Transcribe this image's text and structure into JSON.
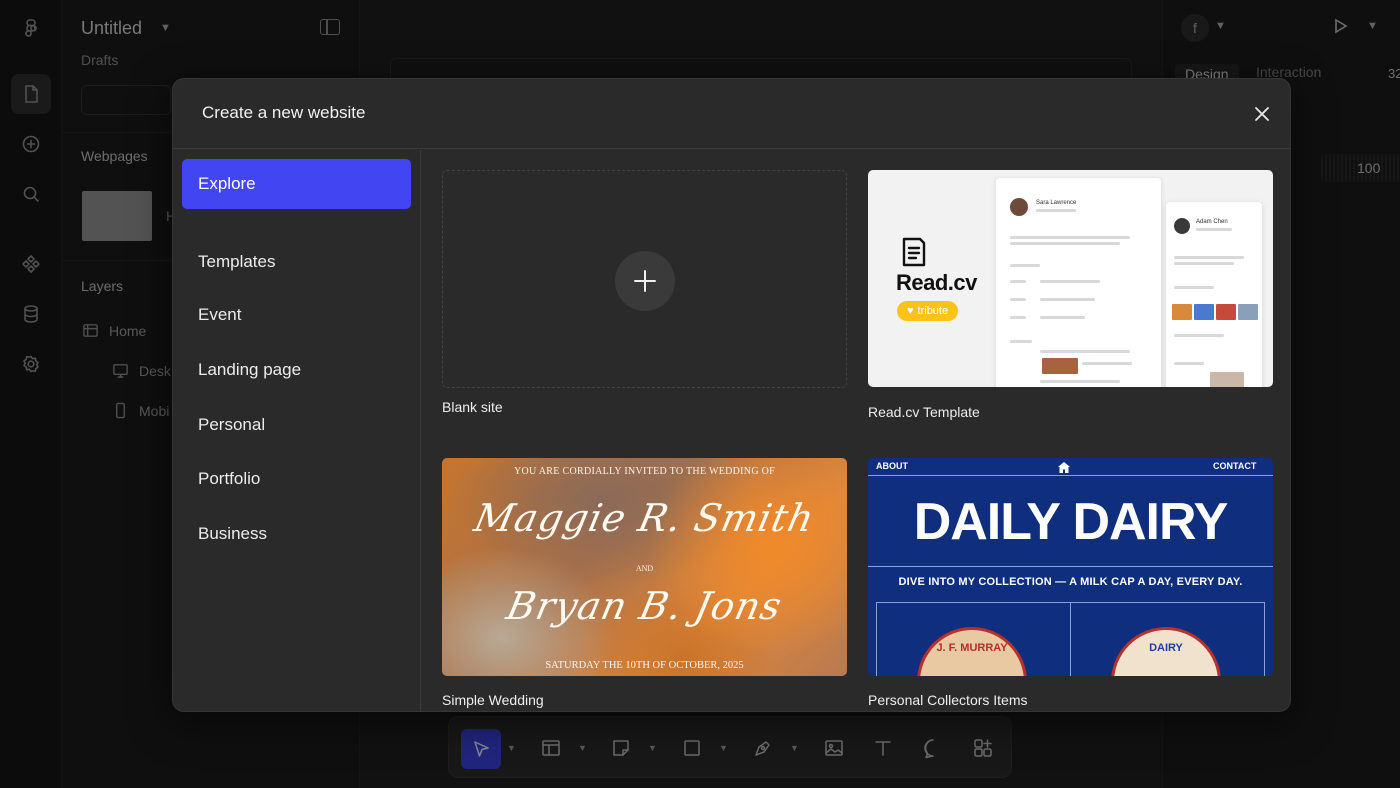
{
  "editor": {
    "file_title": "Untitled",
    "drafts_label": "Drafts",
    "webpages_heading": "Webpages",
    "webpage_partial_label": "H",
    "layers_heading": "Layers",
    "layers": [
      "Home",
      "Desk",
      "Mobi"
    ],
    "avatar_letter": "f",
    "tabs": {
      "design": "Design",
      "interaction": "Interaction"
    },
    "zoom_partial": "32",
    "value_field": "100"
  },
  "toolbar": {
    "tools": [
      "move-tool",
      "frame-tool",
      "section-tool",
      "rectangle-tool",
      "pen-tool",
      "image-tool",
      "text-tool",
      "comment-tool",
      "components-tool"
    ]
  },
  "modal": {
    "title": "Create a new website",
    "nav": [
      "Explore",
      "Templates",
      "Event",
      "Landing page",
      "Personal",
      "Portfolio",
      "Business"
    ],
    "active_nav": "Explore",
    "cards": {
      "blank": {
        "label": "Blank site"
      },
      "readcv": {
        "label": "Read.cv Template",
        "logo": "Read.cv",
        "badge": "tribute",
        "person1": "Sara Lawrence",
        "person2": "Adam Chen"
      },
      "wedding": {
        "label": "Simple Wedding",
        "invite": "YOU ARE CORDIALLY INVITED TO THE WEDDING OF",
        "name1": "Maggie R. Smith",
        "and": "AND",
        "name2": "Bryan B. Jons",
        "date": "SATURDAY THE 10TH OF OCTOBER, 2025"
      },
      "dairy": {
        "label": "Personal Collectors Items",
        "nav_left": "ABOUT",
        "nav_right": "CONTACT",
        "title": "DAILY DAIRY",
        "subtitle": "DIVE INTO MY COLLECTION — A MILK CAP A DAY, EVERY DAY.",
        "cap1": "J. F. MURRAY",
        "cap2": "DAIRY"
      }
    }
  },
  "colors": {
    "accent": "#4246f2",
    "modal_bg": "#2a2a2a",
    "badge_yellow": "#ffc21a",
    "dairy_blue": "#0f2f7e"
  }
}
